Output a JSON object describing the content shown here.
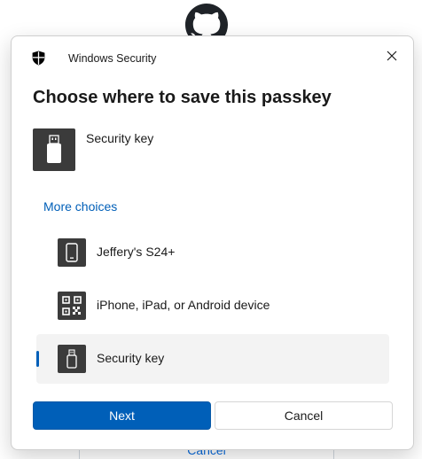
{
  "background": {
    "cancel_link": "Cancel"
  },
  "dialog": {
    "app_title": "Windows Security",
    "heading": "Choose where to save this passkey",
    "selected": {
      "label": "Security key",
      "icon": "usb-key-icon"
    },
    "more_choices": "More choices",
    "options": [
      {
        "label": "Jeffery's S24+",
        "icon": "phone-icon",
        "selected": false
      },
      {
        "label": "iPhone, iPad, or Android device",
        "icon": "qr-code-icon",
        "selected": false
      },
      {
        "label": "Security key",
        "icon": "usb-key-icon",
        "selected": true
      }
    ],
    "buttons": {
      "next": "Next",
      "cancel": "Cancel"
    }
  },
  "colors": {
    "accent": "#005fb8",
    "tile": "#3b3b3b",
    "selected_row": "#f3f3f3",
    "link": "#0969da"
  }
}
